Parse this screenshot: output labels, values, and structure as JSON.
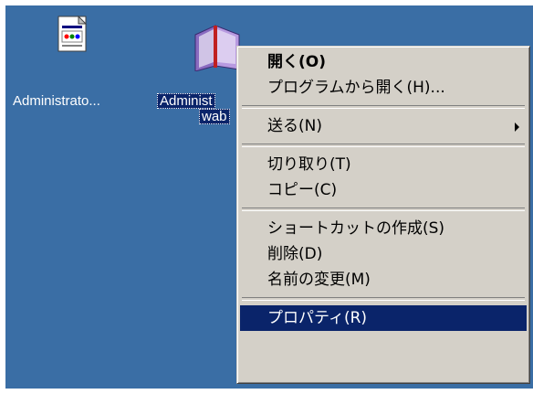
{
  "desktop": {
    "background_color": "#3a6ea5",
    "icons": [
      {
        "label": "Administrato...",
        "icon": "document-icon",
        "selected": false
      },
      {
        "label_line1": "Administ",
        "label_line2": "wab",
        "icon": "address-book-icon",
        "selected": true
      }
    ]
  },
  "context_menu": {
    "items": [
      {
        "label": "開く(O)",
        "bold": true
      },
      {
        "label": "プログラムから開く(H)..."
      },
      {
        "separator": true
      },
      {
        "label": "送る(N)",
        "submenu": true
      },
      {
        "separator": true
      },
      {
        "label": "切り取り(T)"
      },
      {
        "label": "コピー(C)"
      },
      {
        "separator": true
      },
      {
        "label": "ショートカットの作成(S)"
      },
      {
        "label": "削除(D)"
      },
      {
        "label": "名前の変更(M)"
      },
      {
        "separator": true
      },
      {
        "label": "プロパティ(R)",
        "highlighted": true
      }
    ],
    "highlight_color": "#0a246a",
    "background_color": "#d4d0c8"
  }
}
